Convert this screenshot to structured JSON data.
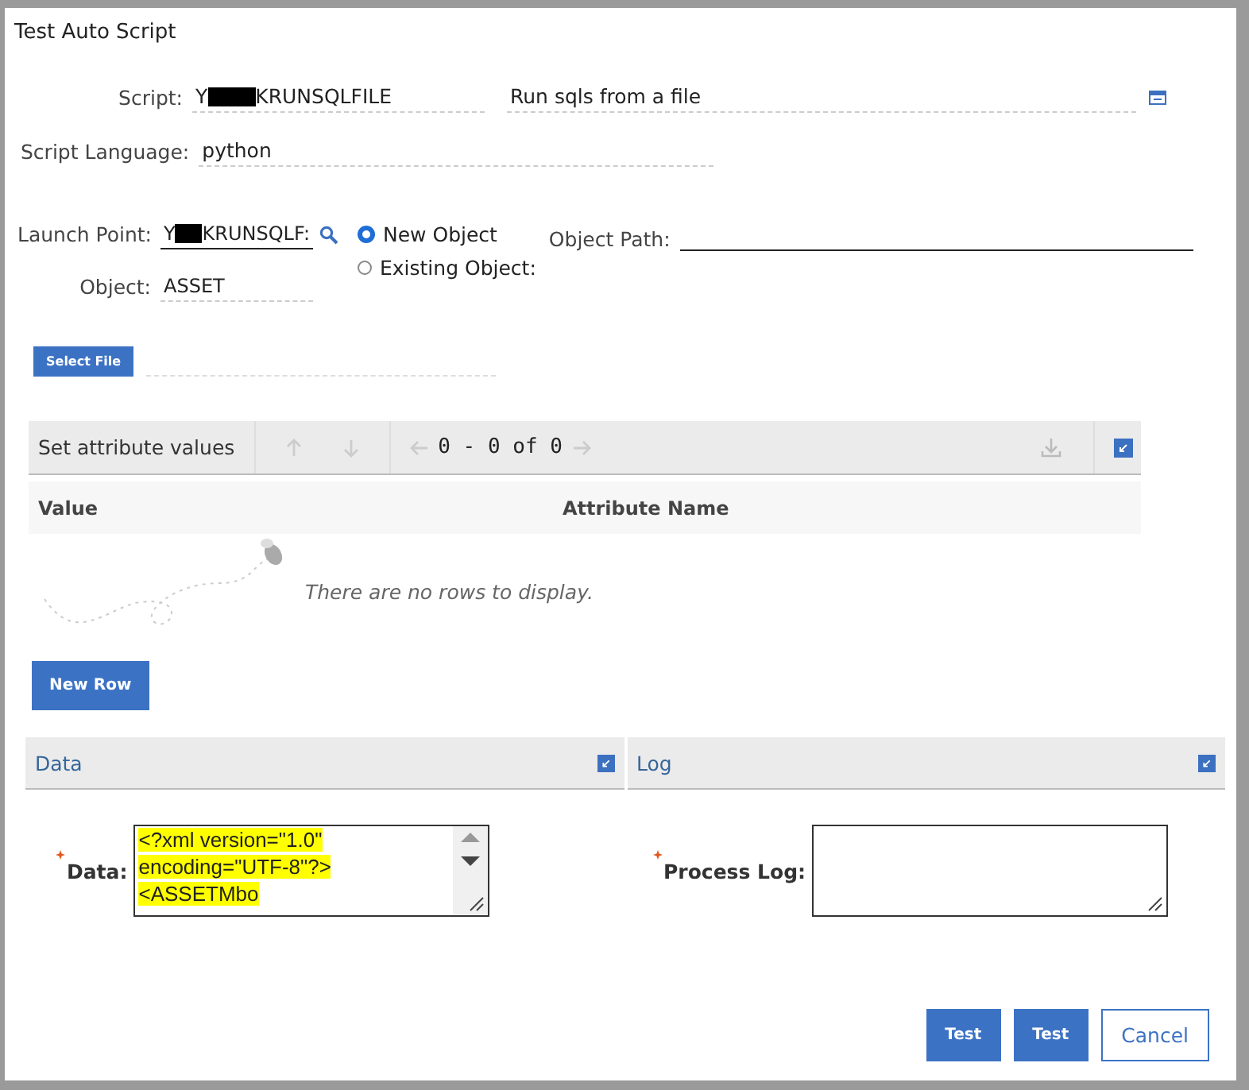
{
  "dialog": {
    "title": "Test Auto Script"
  },
  "script": {
    "label": "Script:",
    "value_prefix": "Y",
    "value": "KRUNSQLFILE",
    "redacted": true,
    "description": "Run sqls from a file"
  },
  "script_language": {
    "label": "Script Language:",
    "value": "python"
  },
  "launch_point": {
    "label": "Launch Point:",
    "value_prefix": "Y",
    "value": "KRUNSQLF:",
    "redacted": true
  },
  "object": {
    "label": "Object:",
    "value": "ASSET"
  },
  "object_options": [
    {
      "label": "New Object",
      "selected": true
    },
    {
      "label": "Existing Object:",
      "selected": false
    }
  ],
  "object_path": {
    "label": "Object Path:"
  },
  "select_file_button": "Select File",
  "attribute_table": {
    "title": "Set attribute values",
    "pagination": "0 - 0 of 0",
    "columns": [
      "Value",
      "Attribute Name"
    ],
    "empty_message": "There are no rows to display."
  },
  "new_row_button": "New Row",
  "sections": [
    {
      "title": "Data",
      "field_label": "Data:",
      "required": true,
      "value": "<?xml version=\"1.0\" encoding=\"UTF-8\"?> <ASSETMbo",
      "highlighted": true
    },
    {
      "title": "Log",
      "field_label": "Process Log:",
      "required": true,
      "highlighted": false
    }
  ],
  "buttons": [
    {
      "label": "Test",
      "kind": "primary"
    },
    {
      "label": "Test",
      "kind": "primary"
    },
    {
      "label": "Cancel",
      "kind": "secondary"
    }
  ]
}
